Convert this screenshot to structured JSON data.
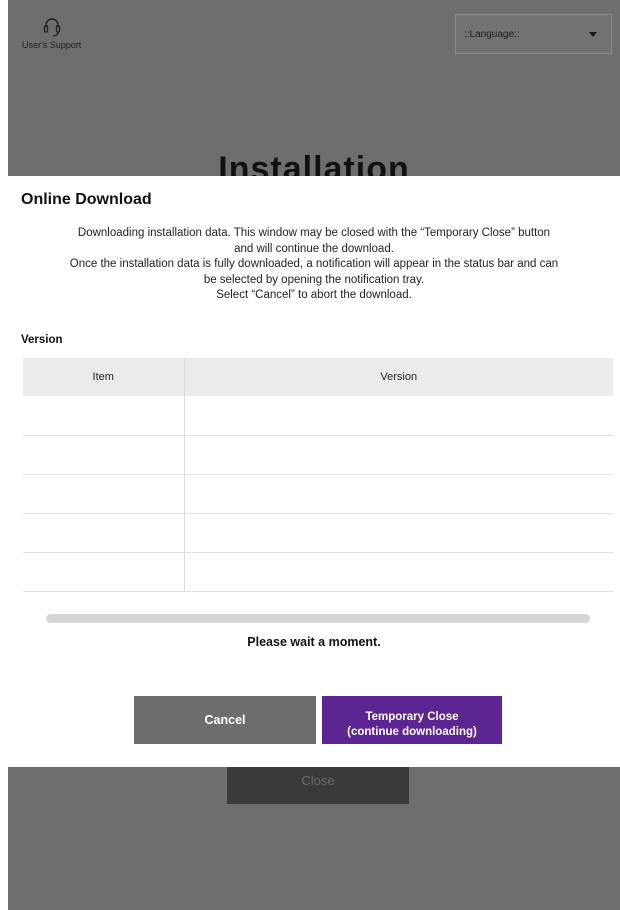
{
  "background": {
    "support_label": "User's Support",
    "language_select": "::Language::",
    "title": "Installation",
    "close_button": "Close"
  },
  "dialog": {
    "title": "Online Download",
    "message_lines": [
      "Downloading installation data. This window may be closed with the “Temporary Close” button",
      "and will continue the download.",
      "Once the installation data is fully downloaded, a notification will appear in the status bar and can",
      "be selected by opening the notification tray.",
      "Select “Cancel” to abort the download."
    ],
    "version_section_label": "Version",
    "table": {
      "headers": [
        "Item",
        "Version"
      ],
      "rows": [
        [
          "",
          ""
        ],
        [
          "",
          ""
        ],
        [
          "",
          ""
        ],
        [
          "",
          ""
        ],
        [
          "",
          ""
        ]
      ]
    },
    "progress_fraction": 0,
    "wait_text": "Please wait a moment.",
    "cancel_button": "Cancel",
    "temp_close_button_line1": "Temporary Close",
    "temp_close_button_line2": "(continue downloading)"
  },
  "colors": {
    "accent": "#5c2592",
    "overlay": "#6e6e6e",
    "cancel": "#6d6d6d"
  },
  "icons": {
    "support": "headset-icon",
    "language": "caret-down-icon"
  }
}
